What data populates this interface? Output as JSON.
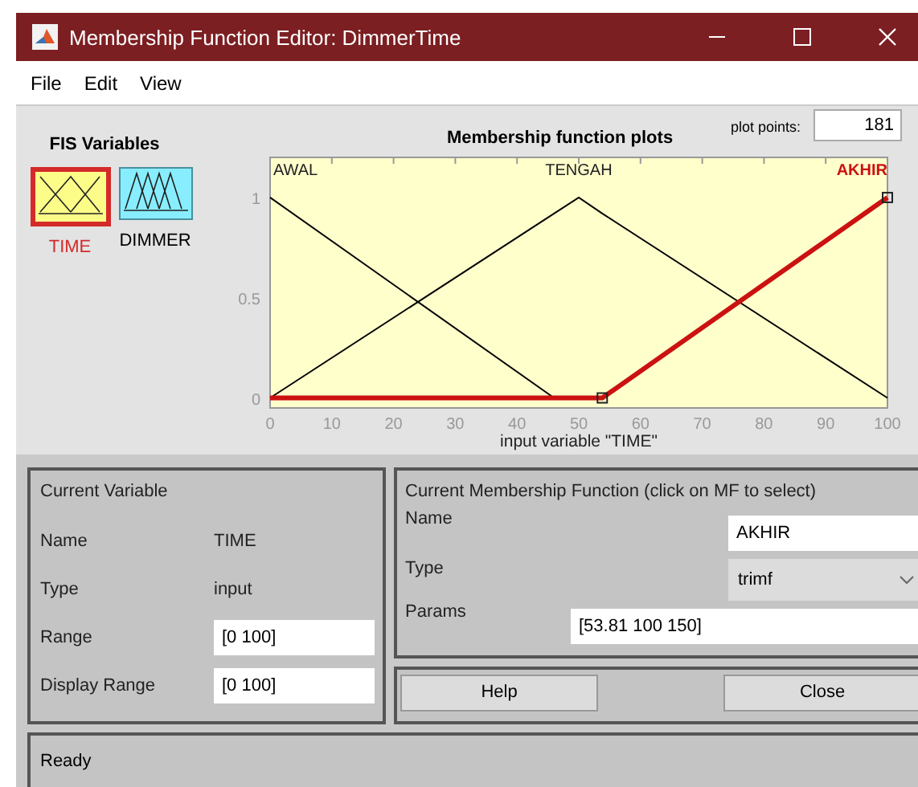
{
  "window": {
    "title": "Membership Function Editor: DimmerTime"
  },
  "menu": [
    "File",
    "Edit",
    "View"
  ],
  "fis_variables": {
    "title": "FIS Variables",
    "items": [
      {
        "label": "TIME",
        "kind": "input",
        "selected": true
      },
      {
        "label": "DIMMER",
        "kind": "output",
        "selected": false
      }
    ]
  },
  "plot": {
    "title": "Membership function plots",
    "plot_points_label": "plot points:",
    "plot_points": "181",
    "chart_data": {
      "type": "line",
      "xlabel": "input variable \"TIME\"",
      "x": [
        0,
        46,
        50,
        53.81,
        100
      ],
      "series": [
        {
          "name": "AWAL",
          "color": "#000000",
          "values": [
            1,
            0,
            null,
            null,
            null
          ]
        },
        {
          "name": "TENGAH",
          "color": "#000000",
          "values": [
            0,
            0.92,
            1,
            0.92,
            0
          ]
        },
        {
          "name": "AKHIR",
          "color": "#cc1111",
          "values": [
            0,
            0,
            0,
            0,
            1
          ]
        }
      ],
      "xlim": [
        0,
        100
      ],
      "ylim": [
        -0.05,
        1.2
      ],
      "xticks": [
        0,
        10,
        20,
        30,
        40,
        50,
        60,
        70,
        80,
        90,
        100
      ],
      "yticks": [
        0,
        0.5,
        1
      ]
    }
  },
  "current_variable": {
    "title": "Current Variable",
    "name_label": "Name",
    "name": "TIME",
    "type_label": "Type",
    "type": "input",
    "range_label": "Range",
    "range": "[0 100]",
    "display_range_label": "Display Range",
    "display_range": "[0 100]"
  },
  "current_mf": {
    "title": "Current Membership Function (click on MF to select)",
    "name_label": "Name",
    "name": "AKHIR",
    "type_label": "Type",
    "type": "trimf",
    "params_label": "Params",
    "params": "[53.81 100 150]"
  },
  "buttons": [
    "Help",
    "Close"
  ],
  "status": "Ready"
}
